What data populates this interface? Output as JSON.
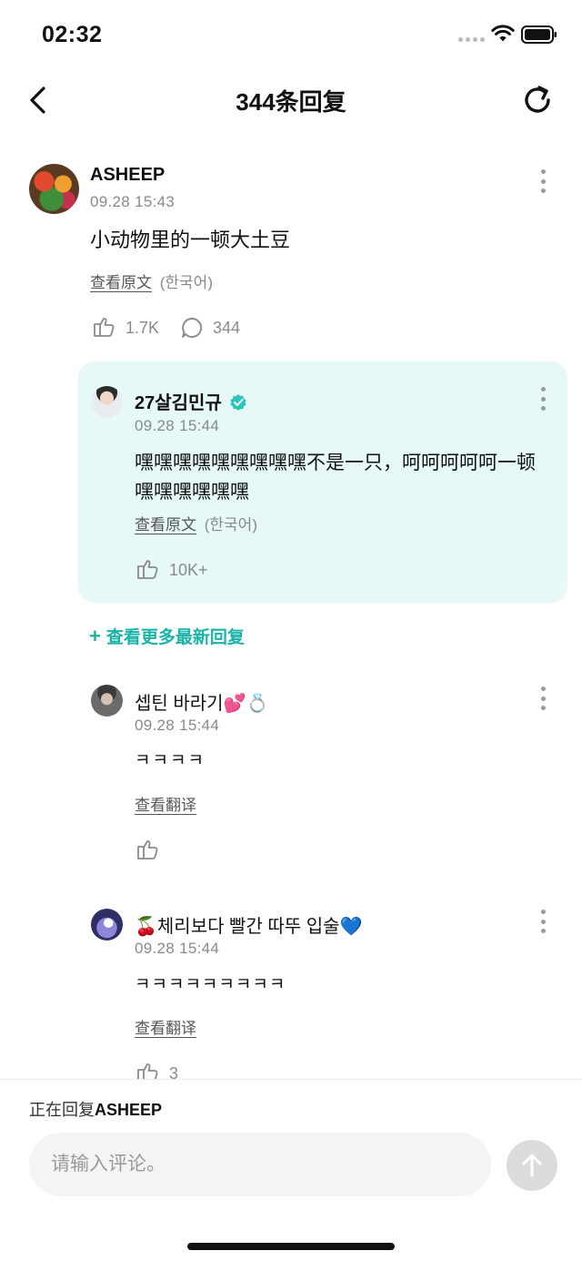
{
  "status_bar": {
    "time": "02:32"
  },
  "nav": {
    "title": "344条回复"
  },
  "main_comment": {
    "username": "ASHEEP",
    "timestamp": "09.28 15:43",
    "text": "小动物里的一顿大土豆",
    "view_original": "查看原文",
    "language": "(한국어)",
    "likes": "1.7K",
    "replies": "344"
  },
  "pinned_reply": {
    "username": "27살김민규",
    "timestamp": "09.28 15:44",
    "text": "嘿嘿嘿嘿嘿嘿嘿嘿嘿不是一只，呵呵呵呵呵一顿嘿嘿嘿嘿嘿嘿",
    "view_original": "查看原文",
    "language": "(한국어)",
    "likes": "10K+"
  },
  "more_replies_label": "查看更多最新回复",
  "replies": [
    {
      "username": "셉틴 바라기💕💍",
      "timestamp": "09.28 15:44",
      "text": "ㅋㅋㅋㅋ",
      "translate": "查看翻译",
      "likes": ""
    },
    {
      "username": "🍒체리보다 빨간 따뚜 입술💙",
      "timestamp": "09.28 15:44",
      "text": "ㅋㅋㅋㅋㅋㅋㅋㅋㅋ",
      "translate": "查看翻译",
      "likes": "3"
    }
  ],
  "composer": {
    "replying_prefix": "正在回复",
    "replying_to": "ASHEEP",
    "placeholder": "请输入评论。"
  },
  "colors": {
    "accent": "#19b3a7",
    "reply_card_bg": "#e6f9f7",
    "muted": "#8a8a8a"
  },
  "icons": [
    "back-icon",
    "refresh-icon",
    "more-icon",
    "like-icon",
    "comment-icon",
    "verified-icon",
    "plus-icon",
    "send-icon",
    "wifi-icon",
    "battery-icon"
  ]
}
